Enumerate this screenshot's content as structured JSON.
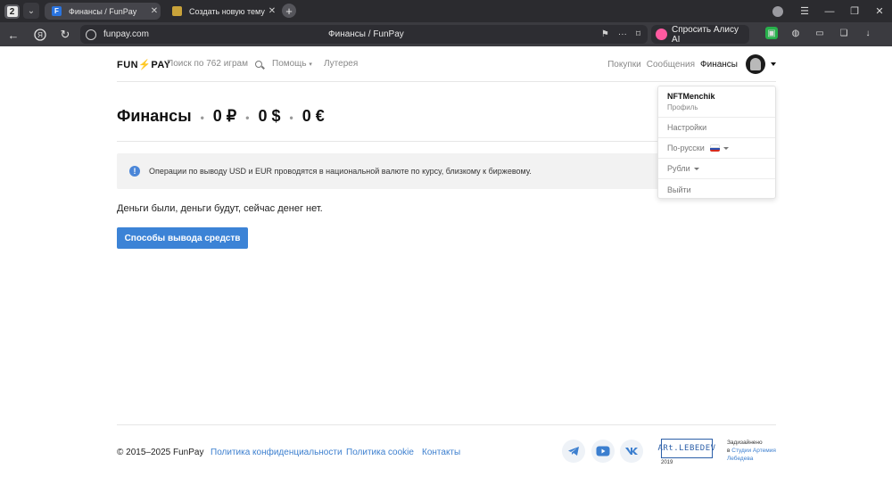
{
  "browser": {
    "tab_count": "2",
    "tabs": [
      {
        "title": "Финансы / FunPay",
        "favicon": "F",
        "favicon_color": "#2a74e0"
      },
      {
        "title": "Создать новую тему - Re",
        "favicon": "",
        "favicon_color": "#c9a33a"
      }
    ],
    "address": {
      "host": "funpay.com",
      "page_title": "Финансы / FunPay"
    },
    "alice_label": "Спросить Алису AI"
  },
  "site": {
    "logo": {
      "part1": "FUN",
      "part2": "PAY"
    },
    "search_placeholder": "Поиск по 762 играм",
    "nav": {
      "help": "Помощь",
      "lottery": "Лутерея"
    },
    "nav_right": [
      "Покупки",
      "Сообщения",
      "Финансы"
    ]
  },
  "page": {
    "title": "Финансы",
    "balances": [
      "0 ₽",
      "0 $",
      "0 €"
    ],
    "separator": "•",
    "notice": "Операции по выводу USD и EUR проводятся в национальной валюте по курсу, близкому к биржевому.",
    "empty_text": "Деньги были, деньги будут, сейчас денег нет.",
    "withdraw_button": "Способы вывода средств"
  },
  "dropdown": {
    "username": "NFTMenchik",
    "profile_label": "Профиль",
    "settings": "Настройки",
    "language": "По-русски",
    "currency": "Рубли",
    "logout": "Выйти"
  },
  "footer": {
    "copyright": "© 2015–2025 FunPay",
    "links": [
      "Политика конфиденциальности",
      "Политика cookie",
      "Контакты"
    ],
    "lebedev_logo": "ARt.LEBEDEV",
    "lebedev_year": "2019",
    "designed_line1": "Задизайнено",
    "designed_in": "в",
    "designed_link": "Студии Артемия Лебедева"
  },
  "colors": {
    "accent": "#3c83d6",
    "link": "#3c7fcf"
  }
}
